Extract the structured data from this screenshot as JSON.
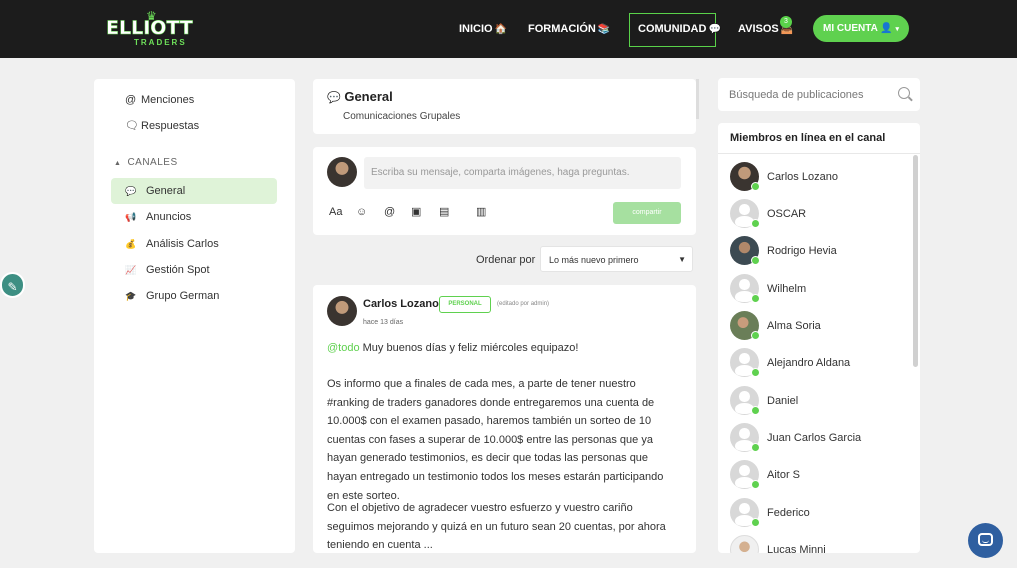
{
  "brand": {
    "logo_main": "ELLIOTT",
    "logo_sub": "TRADERS"
  },
  "nav": {
    "inicio": "INICIO",
    "formacion": "FORMACIÓN",
    "comunidad": "COMUNIDAD",
    "avisos": "AVISOS",
    "avisos_count": "3",
    "cuenta": "MI CUENTA"
  },
  "sidebar": {
    "menciones": "Menciones",
    "respuestas": "Respuestas",
    "canales_heading": "CANALES",
    "channels": [
      {
        "label": "General",
        "icon": "speech-bubble-icon"
      },
      {
        "label": "Anuncios",
        "icon": "megaphone-icon"
      },
      {
        "label": "Análisis Carlos",
        "icon": "money-bag-icon"
      },
      {
        "label": "Gestión Spot",
        "icon": "chart-icon"
      },
      {
        "label": "Grupo German",
        "icon": "graduation-cap-icon"
      }
    ]
  },
  "channel_header": {
    "title": "General",
    "subtitle": "Comunicaciones Grupales"
  },
  "composer": {
    "placeholder": "Escriba su mensaje, comparta imágenes, haga preguntas.",
    "font_tool": "Aa",
    "share_label": "compartir"
  },
  "sort": {
    "label": "Ordenar por",
    "selected": "Lo más nuevo primero"
  },
  "post": {
    "author": "Carlos Lozano",
    "badge": "PERSONAL",
    "edited": "(editado por admin)",
    "time_ago": "hace 13 días",
    "mention": "@todo",
    "greeting": " Muy buenos días y feliz miércoles equipazo!",
    "paragraph1": "Os informo que a finales de cada mes, a parte de tener nuestro #ranking de traders ganadores donde entregaremos una cuenta de 10.000$ con el examen pasado, haremos también un sorteo de 10 cuentas con fases a superar de 10.000$ entre las personas que ya hayan generado testimonios, es decir que todas las personas que hayan entregado un testimonio todos los meses estarán participando en este sorteo.",
    "paragraph2": "Con el objetivo de agradecer vuestro esfuerzo y vuestro cariño seguimos mejorando y quizá en un futuro sean 20 cuentas, por ahora teniendo en cuenta ..."
  },
  "search": {
    "placeholder": "Búsqueda de publicaciones"
  },
  "members": {
    "heading": "Miembros en línea en el canal",
    "list": [
      {
        "name": "Carlos Lozano"
      },
      {
        "name": "OSCAR"
      },
      {
        "name": "Rodrigo Hevia"
      },
      {
        "name": "Wilhelm"
      },
      {
        "name": "Alma Soria"
      },
      {
        "name": "Alejandro Aldana"
      },
      {
        "name": "Daniel"
      },
      {
        "name": "Juan Carlos Garcia"
      },
      {
        "name": "Aitor S"
      },
      {
        "name": "Federico"
      },
      {
        "name": "Lucas Minni"
      }
    ]
  },
  "colors": {
    "accent": "#5fd14f",
    "topbar": "#1c1c1c",
    "fab": "#3d8f83",
    "chat": "#2f5fa0"
  }
}
